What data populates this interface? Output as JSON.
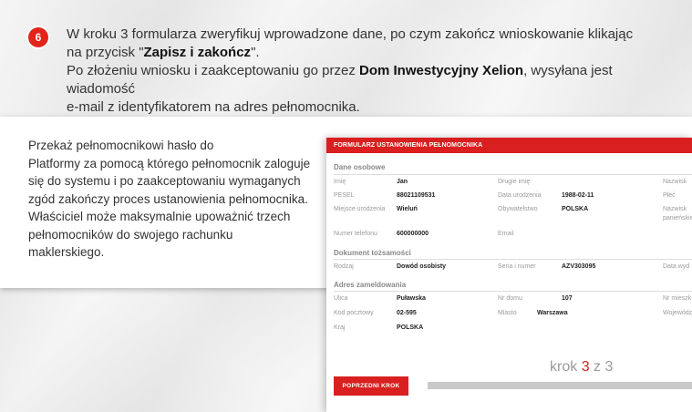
{
  "step": {
    "number": "6"
  },
  "intro": {
    "p1_before": "W kroku 3 formularza zweryfikuj wprowadzone dane, po czym zakończ wnioskowanie klikając",
    "p1_line2_before": "na przycisk \"",
    "p1_bold": "Zapisz i zakończ",
    "p1_after": "\".",
    "p2_before": "Po złożeniu wniosku i zaakceptowaniu go przez ",
    "p2_bold": "Dom Inwestycyjny Xelion",
    "p2_after": ", wysyłana jest wiadomość",
    "p2_line2": "e-mail z identyfikatorem na adres pełnomocnika."
  },
  "description": {
    "lines": [
      "Przekaż pełnomocnikowi hasło do",
      "Platformy za pomocą którego pełnomocnik zaloguje",
      "się do systemu i po zaakceptowaniu wymaganych",
      "zgód zakończy proces ustanowienia pełnomocnika.",
      "Właściciel może maksymalnie upoważnić trzech",
      "pełnomocników do swojego rachunku maklerskiego."
    ]
  },
  "form": {
    "title": "FORMULARZ USTANOWIENIA PEŁNOMOCNIKA",
    "personal": {
      "section": "Dane osobowe",
      "imie_label": "Imię",
      "imie_value": "Jan",
      "drugie_imie_label": "Drugie imię",
      "nazwisko_label": "Nazwisk",
      "pesel_label": "PESEL",
      "pesel_value": "88021109531",
      "data_ur_label": "Data urodzenia",
      "data_ur_value": "1988-02-11",
      "plec_label": "Płeć",
      "miejsce_label": "Miejsce urodzenia",
      "miejsce_value": "Wieluń",
      "obyw_label": "Obywatelstwo",
      "obyw_value": "POLSKA",
      "panienskie_label_1": "Nazwisk",
      "panienskie_label_2": "panieńskie",
      "telefon_label": "Numer telefonu",
      "telefon_value": "600000000",
      "email_label": "Email"
    },
    "document": {
      "section": "Dokument tożsamości",
      "rodzaj_label": "Rodzaj",
      "rodzaj_value": "Dowód osobisty",
      "seria_label": "Seria i numer",
      "seria_value": "AZV303095",
      "data_wyd_label": "Data wyd"
    },
    "address": {
      "section": "Adres zameldowania",
      "ulica_label": "Ulica",
      "ulica_value": "Puławska",
      "nr_domu_label": "Nr domu",
      "nr_domu_value": "107",
      "nr_mieszk_label": "Nr mieszk",
      "kod_label": "Kod pocztowy",
      "kod_value": "02-595",
      "miasto_label": "Miasto",
      "miasto_value": "Warszawa",
      "wojew_label": "Województ",
      "kraj_label": "Kraj",
      "kraj_value": "POLSKA"
    },
    "prev_button": "POPRZEDNI KROK",
    "krok": {
      "word": "krok",
      "current": "3",
      "sep": "z",
      "total": "3"
    }
  },
  "colors": {
    "accent": "#d91f1f",
    "badge": "#e3241b"
  },
  "progress": {
    "fraction": 1.0
  }
}
